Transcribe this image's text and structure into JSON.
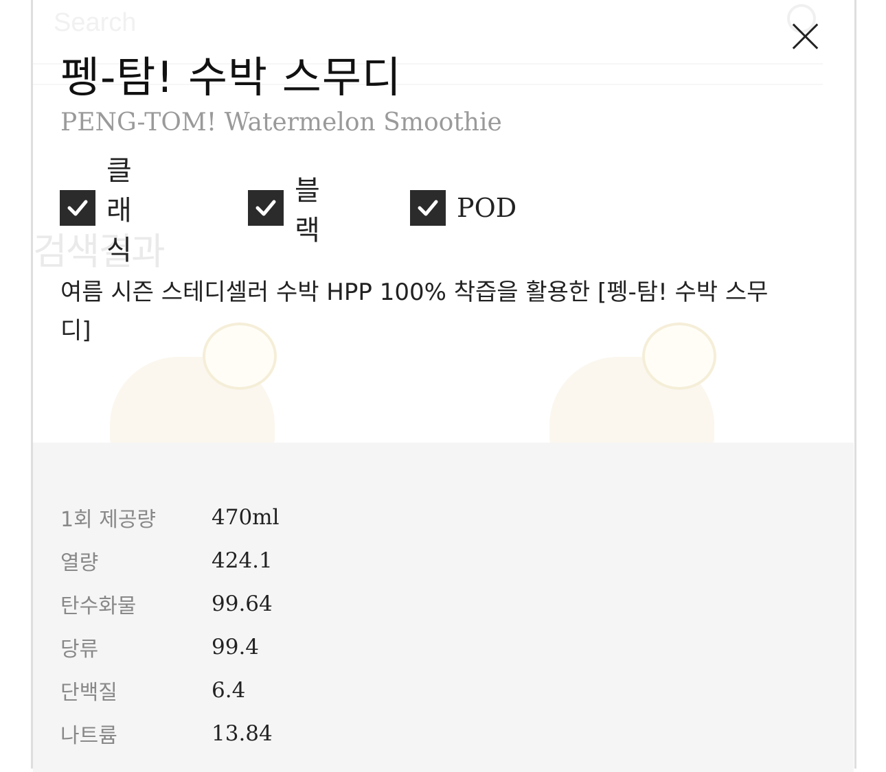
{
  "background": {
    "search_placeholder": "Search",
    "heading": "검색결과"
  },
  "modal": {
    "title_kr": "펭-탐! 수박 스무디",
    "title_en": "PENG-TOM! Watermelon Smoothie",
    "tags": [
      {
        "label": "클래식",
        "checked": true
      },
      {
        "label": "블랙",
        "checked": true
      },
      {
        "label": "POD",
        "checked": true
      }
    ],
    "description": "여름 시즌 스테디셀러 수박 HPP 100% 착즙을 활용한 [펭-탐! 수박 스무디]",
    "nutrition": [
      {
        "label": "1회 제공량",
        "value": "470ml"
      },
      {
        "label": "열량",
        "value": "424.1"
      },
      {
        "label": "탄수화물",
        "value": "99.64"
      },
      {
        "label": "당류",
        "value": "99.4"
      },
      {
        "label": "단백질",
        "value": "6.4"
      },
      {
        "label": "나트륨",
        "value": "13.84"
      }
    ],
    "colors": {
      "checkbox": "#2b2b2b",
      "nutrition_bg": "#f5f5f5",
      "subtitle": "#9a9a9a"
    }
  }
}
